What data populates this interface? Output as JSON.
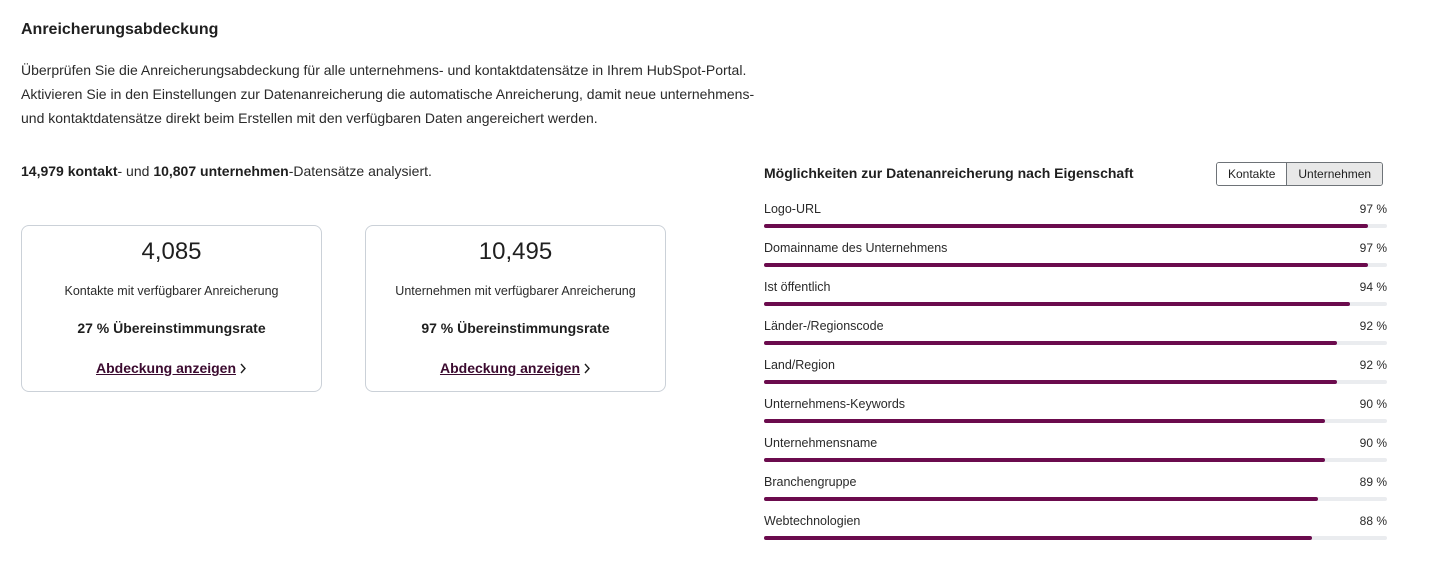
{
  "page": {
    "title": "Anreicherungsabdeckung",
    "intro_lines": [
      "Überprüfen Sie die Anreicherungsabdeckung für alle unternehmens- und kontaktdatensätze in Ihrem HubSpot-Portal.",
      "Aktivieren Sie in den Einstellungen zur Datenanreicherung die automatische Anreicherung, damit neue unternehmens-",
      "und kontaktdatensätze direkt beim Erstellen mit den verfügbaren Daten angereichert werden."
    ]
  },
  "summary": {
    "contacts_count": "14,979 kontakt",
    "between": "- und ",
    "companies_count": "10,807 unternehmen",
    "suffix": "-Datensätze analysiert."
  },
  "cards": [
    {
      "number": "4,085",
      "label": "Kontakte mit verfügbarer Anreicherung",
      "match_rate": "27 % Übereinstimmungsrate",
      "link": "Abdeckung anzeigen"
    },
    {
      "number": "10,495",
      "label": "Unternehmen mit verfügbarer Anreicherung",
      "match_rate": "97 % Übereinstimmungsrate",
      "link": "Abdeckung anzeigen"
    }
  ],
  "properties_panel": {
    "title": "Möglichkeiten zur Datenanreicherung nach Eigenschaft",
    "toggle": {
      "options": [
        "Kontakte",
        "Unternehmen"
      ],
      "selected": "Unternehmen"
    },
    "bar_color": "#6b0b4d",
    "track_color": "#eaecef",
    "items": [
      {
        "name": "Logo-URL",
        "percent_label": "97 %",
        "percent": 97
      },
      {
        "name": "Domainname des Unternehmens",
        "percent_label": "97 %",
        "percent": 97
      },
      {
        "name": "Ist öffentlich",
        "percent_label": "94 %",
        "percent": 94
      },
      {
        "name": "Länder-/Regionscode",
        "percent_label": "92 %",
        "percent": 92
      },
      {
        "name": "Land/Region",
        "percent_label": "92 %",
        "percent": 92
      },
      {
        "name": "Unternehmens-Keywords",
        "percent_label": "90 %",
        "percent": 90
      },
      {
        "name": "Unternehmensname",
        "percent_label": "90 %",
        "percent": 90
      },
      {
        "name": "Branchengruppe",
        "percent_label": "89 %",
        "percent": 89
      },
      {
        "name": "Webtechnologien",
        "percent_label": "88 %",
        "percent": 88
      }
    ]
  }
}
